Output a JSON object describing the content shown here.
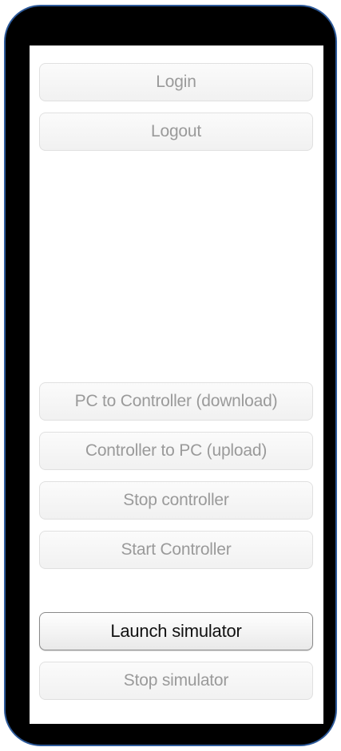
{
  "buttons": {
    "login": "Login",
    "logout": "Logout",
    "pc_to_controller": "PC to Controller (download)",
    "controller_to_pc": "Controller to PC (upload)",
    "stop_controller": "Stop controller",
    "start_controller": "Start Controller",
    "launch_simulator": "Launch simulator",
    "stop_simulator": "Stop simulator"
  },
  "colors": {
    "frame": "#000000",
    "frame_border": "#2d5a9a",
    "disabled_text": "#9a9a9a",
    "enabled_text": "#111111"
  }
}
